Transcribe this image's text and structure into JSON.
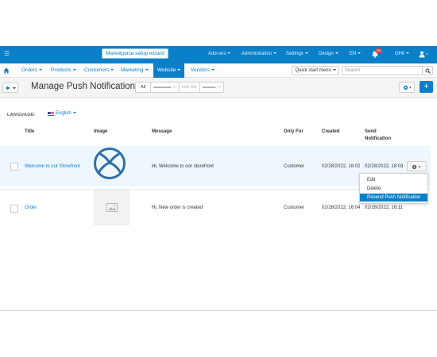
{
  "topbar": {
    "wizard_label": "Marketplace setup wizard",
    "items": [
      "Add-ons",
      "Administration",
      "Settings",
      "Design",
      "EN",
      "GH¢"
    ],
    "notification_count": "99"
  },
  "nav": {
    "items": [
      "Orders",
      "Products",
      "Customers",
      "Marketing",
      "Website",
      "Vendors"
    ],
    "active": "Website",
    "quick_start": "Quick start menu",
    "search_placeholder": "Search"
  },
  "titlebar": {
    "title": "Manage Push Notification",
    "filters": [
      "All",
      "▬▬▬▬ ▭",
      "Into Sto",
      "▬▬▬ ▭"
    ]
  },
  "language": {
    "label": "LANGUAGE:",
    "value": "English"
  },
  "table": {
    "headers": {
      "title": "Title",
      "image": "Image",
      "message": "Message",
      "only_for": "Only For",
      "created": "Created",
      "send_line1": "Send",
      "send_line2": "Notification"
    },
    "rows": [
      {
        "title": "Welcome to our Storefront",
        "message": "Hi, Welcome to oor storefront",
        "only_for": "Customer",
        "created": "02/28/2022, 18:02",
        "send": "02/28/2022, 18:03"
      },
      {
        "title": "Order",
        "message": "Hi, New order is created",
        "only_for": "Customer",
        "created": "02/28/2022, 16:04",
        "send": "02/28/2022, 16:11"
      }
    ]
  },
  "dropdown": {
    "items": [
      "Edit",
      "Delete",
      "Resend Push Notification"
    ],
    "highlighted": "Resend Push Notification"
  },
  "colors": {
    "primary": "#0b80c8",
    "row_highlight": "#eef7fd",
    "badge": "#e8424a",
    "logo": "#2f6fa6"
  }
}
